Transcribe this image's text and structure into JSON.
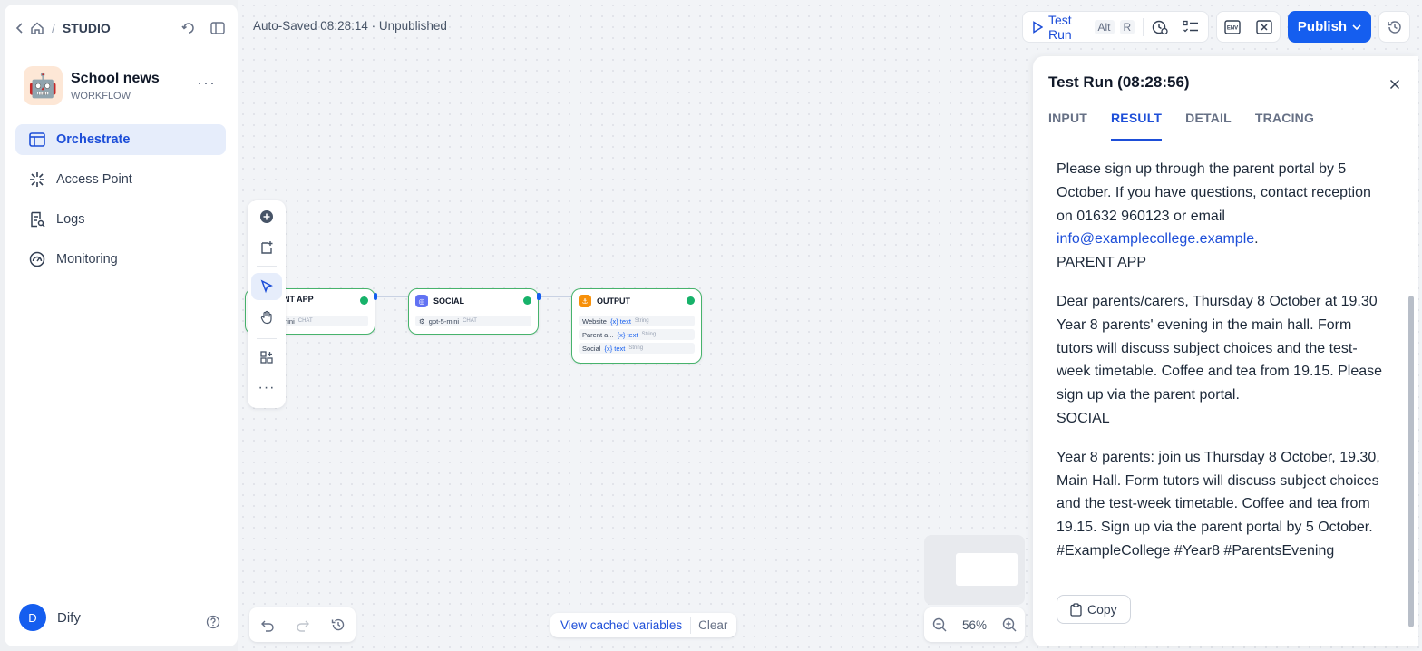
{
  "header": {
    "breadcrumb_label": "STUDIO",
    "autosave_text": "Auto-Saved 08:28:14 · Unpublished",
    "test_run_label": "Test Run",
    "shortcut_alt": "Alt",
    "shortcut_key": "R",
    "env_label": "ENV",
    "publish_label": "Publish"
  },
  "app": {
    "name": "School news",
    "type": "WORKFLOW",
    "avatar_emoji": "🤖"
  },
  "sidebar": {
    "items": [
      {
        "label": "Orchestrate",
        "icon": "layout-icon",
        "active": true
      },
      {
        "label": "Access Point",
        "icon": "sparkle-icon",
        "active": false
      },
      {
        "label": "Logs",
        "icon": "file-list-icon",
        "active": false
      },
      {
        "label": "Monitoring",
        "icon": "gauge-icon",
        "active": false
      }
    ],
    "user_initial": "D",
    "user_name": "Dify"
  },
  "canvas": {
    "nodes": [
      {
        "title": "ENT APP",
        "model": "mini",
        "tag": "CHAT"
      },
      {
        "title": "SOCIAL",
        "model": "gpt-5-mini",
        "tag": "CHAT"
      },
      {
        "title": "OUTPUT",
        "outputs": [
          {
            "name": "Website",
            "var": "{x} text",
            "type": "String"
          },
          {
            "name": "Parent a...",
            "var": "{x} text",
            "type": "String"
          },
          {
            "name": "Social",
            "var": "{x} text",
            "type": "String"
          }
        ]
      }
    ],
    "view_cached_label": "View cached variables",
    "clear_label": "Clear",
    "zoom": "56%"
  },
  "panel": {
    "title": "Test Run (08:28:56)",
    "tabs": [
      "INPUT",
      "RESULT",
      "DETAIL",
      "TRACING"
    ],
    "active_tab": "RESULT",
    "para1_text": "Please sign up through the parent portal by 5 October. If you have questions, contact reception on 01632 960123 or email ",
    "email": "info@examplecollege.example",
    "para1_end": ".",
    "heading1": "PARENT APP",
    "para2": "Dear parents/carers, Thursday 8 October at 19.30 Year 8 parents' evening in the main hall. Form tutors will discuss subject choices and the test-week timetable. Coffee and tea from 19.15. Please sign up via the parent portal.",
    "heading2": "SOCIAL",
    "para3": "Year 8 parents: join us Thursday 8 October, 19.30, Main Hall. Form tutors will discuss subject choices and the test-week timetable. Coffee and tea from 19.15. Sign up via the parent portal by 5 October. #ExampleCollege #Year8 #ParentsEvening",
    "copy_label": "Copy"
  },
  "colors": {
    "accent": "#155eef",
    "success": "#17b26a",
    "active_nav_bg": "#e6edfb"
  }
}
